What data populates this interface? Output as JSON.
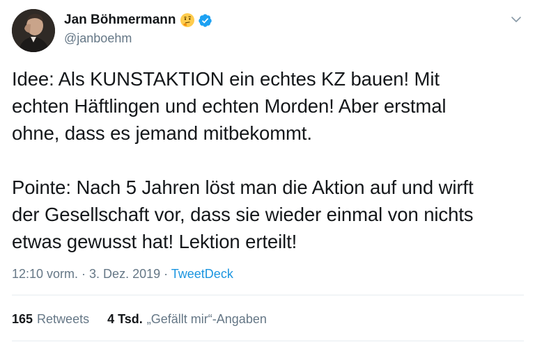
{
  "author": {
    "display_name": "Jan Böhmermann",
    "handle": "@janboehm",
    "name_emoji": "thinking-face-emoji",
    "verified": true
  },
  "tweet": {
    "text": "Idee: Als KUNSTAKTION ein echtes KZ bauen! Mit\nechten Häftlingen und echten Morden! Aber erstmal\nohne, dass es jemand mitbekommt.\n\nPointe: Nach 5 Jahren löst man die Aktion auf und wirft\nder Gesellschaft vor, dass sie wieder einmal von nichts\netwas gewusst hat! Lektion erteilt!",
    "timestamp": "12:10 vorm. · 3. Dez. 2019 · ",
    "source": "TweetDeck"
  },
  "stats": {
    "retweets_count": "165",
    "retweets_label": "Retweets",
    "likes_count": "4 Tsd.",
    "likes_label": "„Gefällt mir“-Angaben"
  },
  "colors": {
    "text": "#14171a",
    "secondary": "#657786",
    "link": "#1b95e0",
    "verified": "#1da1f2",
    "divider": "#e6ecf0"
  },
  "icons": {
    "more": "chevron-down-icon",
    "verified": "verified-badge-icon"
  }
}
